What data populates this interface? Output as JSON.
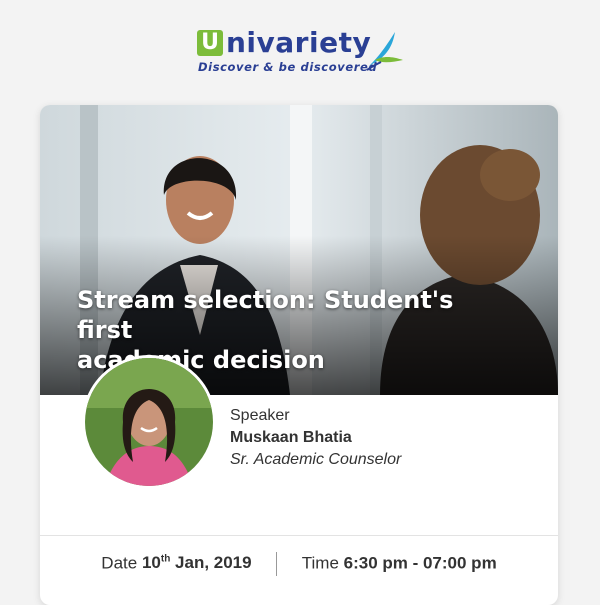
{
  "brand": {
    "badge": "U",
    "name": "nivariety",
    "tagline": "Discover & be discovered"
  },
  "event": {
    "title_line1": "Stream selection: Student's first",
    "title_line2": "academic decision"
  },
  "speaker": {
    "role_label": "Speaker",
    "name": "Muskaan Bhatia",
    "title": "Sr. Academic Counselor"
  },
  "schedule": {
    "date_label": "Date",
    "date_day": "10",
    "date_suffix": "th",
    "date_rest": " Jan, 2019",
    "time_label": "Time",
    "time_value": "6:30 pm - 07:00 pm"
  },
  "colors": {
    "brand_blue": "#2a3f94",
    "brand_green": "#7cbc3a",
    "background": "#f3f3f3"
  }
}
